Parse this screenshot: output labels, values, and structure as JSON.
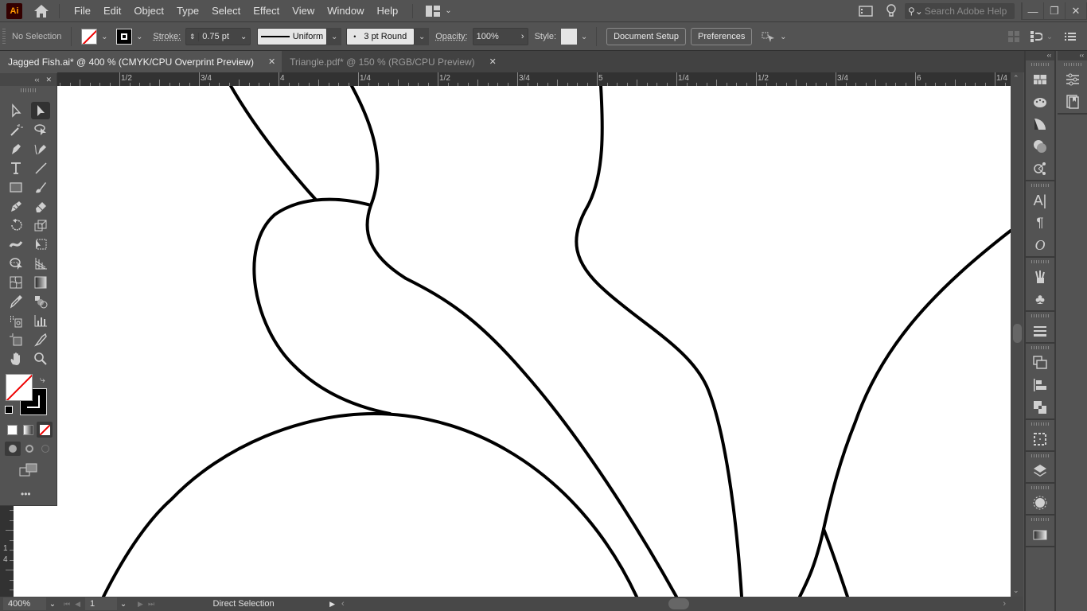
{
  "app": {
    "logo": "Ai",
    "name": "Adobe Illustrator"
  },
  "menubar": {
    "items": [
      "File",
      "Edit",
      "Object",
      "Type",
      "Select",
      "Effect",
      "View",
      "Window",
      "Help"
    ],
    "search_placeholder": "Search Adobe Help",
    "window_controls": {
      "minimize": "—",
      "restore": "❐",
      "close": "✕"
    }
  },
  "controlbar": {
    "selection": "No Selection",
    "stroke_label": "Stroke:",
    "stroke_weight": "0.75 pt",
    "variable_width": "Uniform",
    "brush": "3 pt Round",
    "brush_dot": "•",
    "opacity_label": "Opacity:",
    "opacity_value": "100%",
    "style_label": "Style:",
    "document_setup": "Document Setup",
    "preferences": "Preferences",
    "colors": {
      "fill": "none",
      "stroke": "#000000"
    }
  },
  "tabs": [
    {
      "label": "Jagged Fish.ai* @ 400 % (CMYK/CPU Overprint Preview)",
      "active": true,
      "close": "✕"
    },
    {
      "label": "Triangle.pdf* @ 150 % (RGB/CPU Preview)",
      "active": false,
      "close": "✕"
    }
  ],
  "ruler": {
    "labels": [
      "1/2",
      "3/4",
      "4",
      "1/4",
      "1/2",
      "3/4",
      "5",
      "1/4",
      "1/2",
      "3/4",
      "6",
      "1/4"
    ],
    "vertical_labels": [
      "1",
      "4"
    ]
  },
  "toolbar": {
    "collapse": "‹‹",
    "close": "✕",
    "tools": [
      "selection-tool",
      "direct-selection-tool",
      "magic-wand-tool",
      "lasso-tool",
      "pen-tool",
      "curvature-tool",
      "type-tool",
      "line-segment-tool",
      "rectangle-tool",
      "paintbrush-tool",
      "shaper-tool",
      "eraser-tool",
      "rotate-tool",
      "scale-tool",
      "width-tool",
      "free-transform-tool",
      "shape-builder-tool",
      "perspective-grid-tool",
      "mesh-tool",
      "gradient-tool",
      "eyedropper-tool",
      "blend-tool",
      "symbol-sprayer-tool",
      "column-graph-tool",
      "artboard-tool",
      "slice-tool",
      "hand-tool",
      "zoom-tool"
    ],
    "active_tool": "direct-selection-tool",
    "more": "•••"
  },
  "statusbar": {
    "zoom": "400%",
    "artboard": "1",
    "current_tool": "Direct Selection"
  },
  "panels": {
    "dock1": [
      "swatches",
      "color-guide",
      "gradient-panel",
      "transparency",
      "appearance",
      "character",
      "paragraph",
      "opentype",
      "brushes",
      "symbols",
      "stroke",
      "transform",
      "align",
      "pathfinder",
      "artboards",
      "layers",
      "graphic-styles",
      "gradient"
    ],
    "dock2": [
      "properties",
      "libraries"
    ],
    "collapse": "‹‹"
  }
}
